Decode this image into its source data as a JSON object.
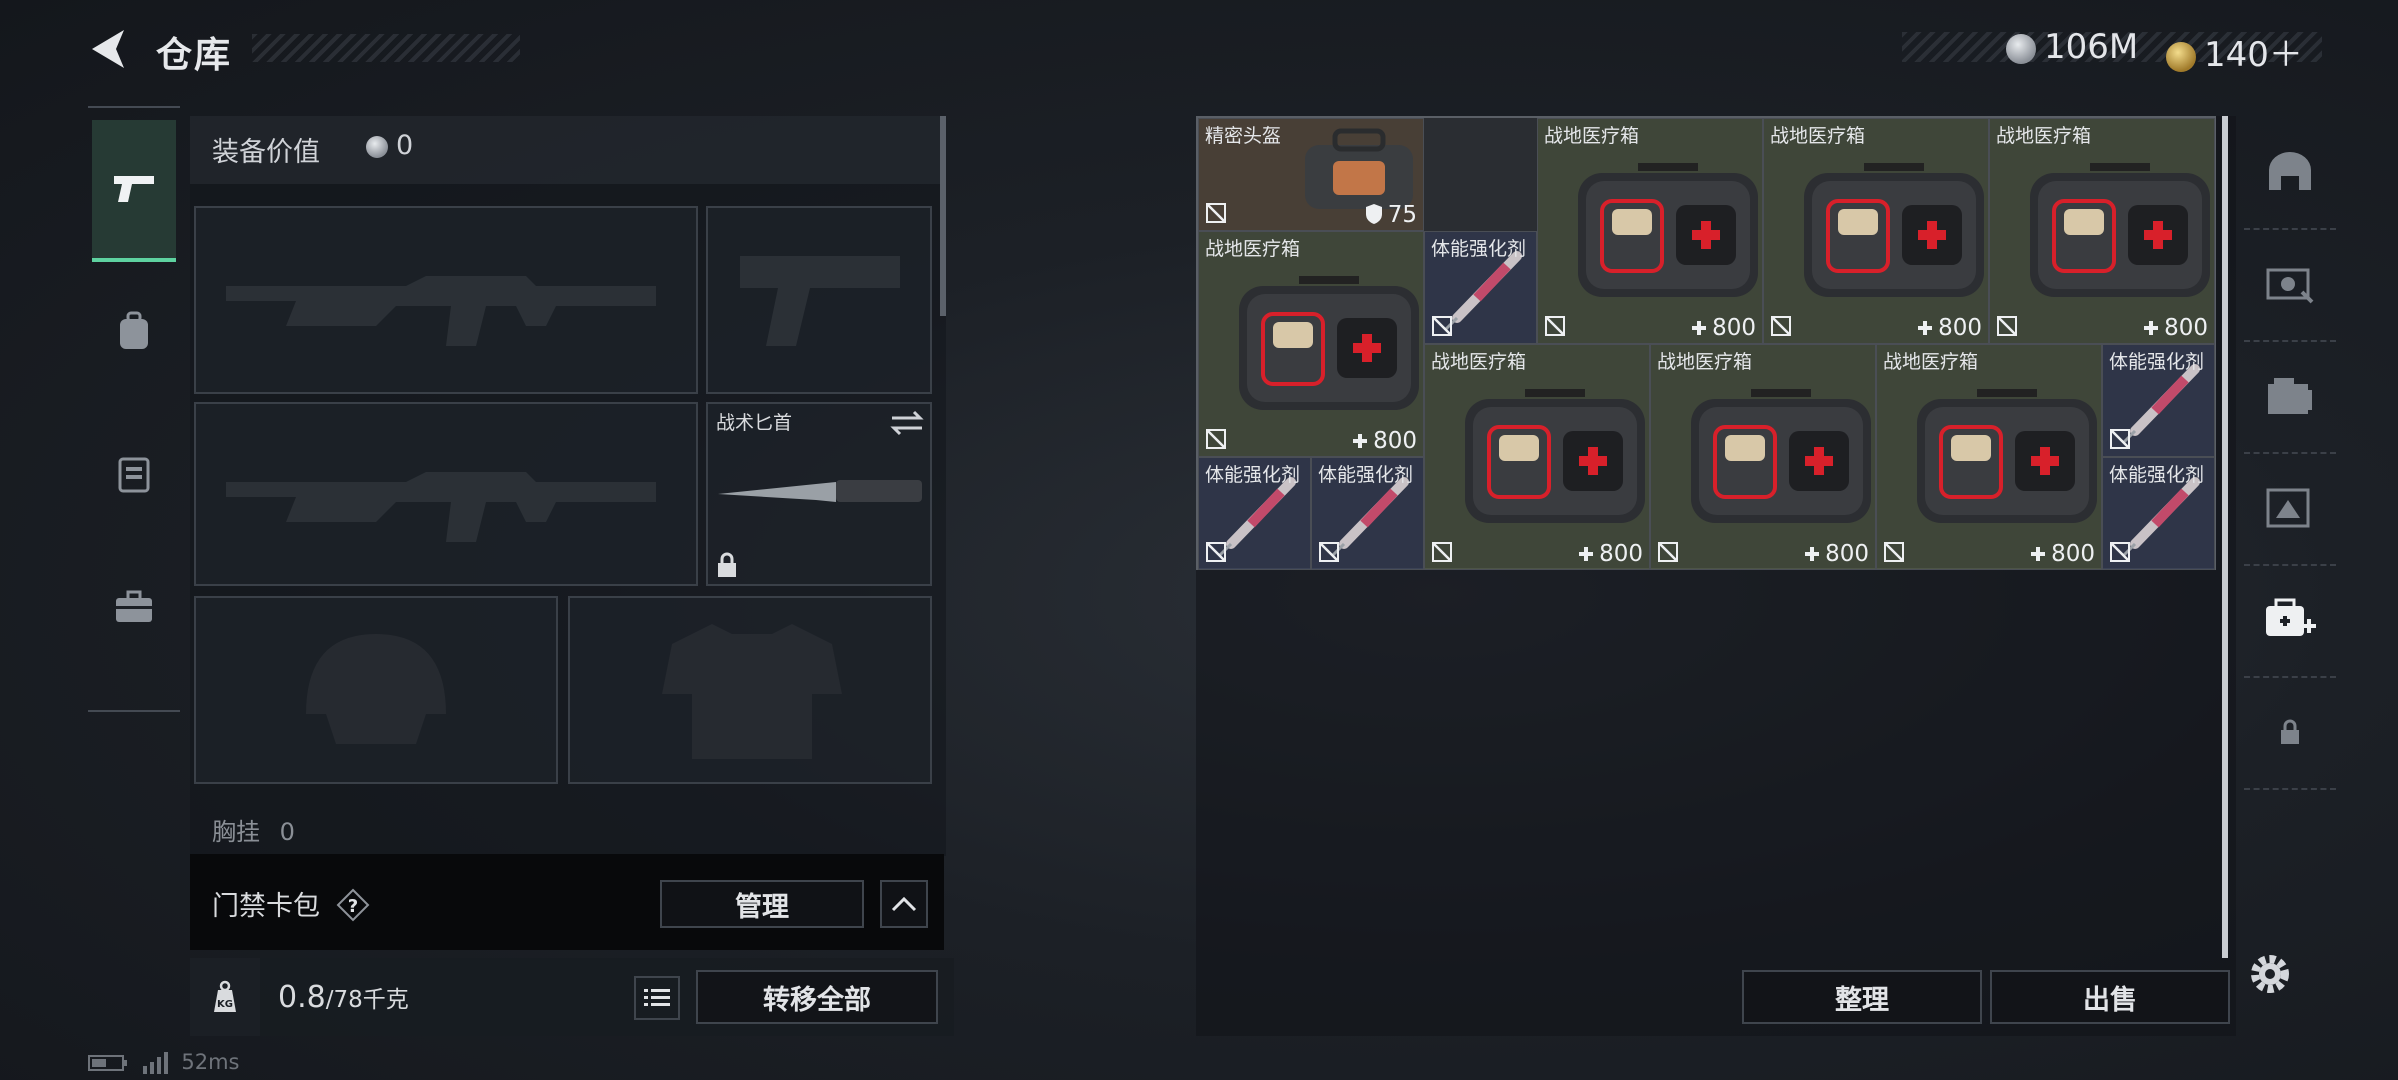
{
  "header": {
    "title": "仓库",
    "currency_silver": "106M",
    "currency_gold": "140＋"
  },
  "left_tabs": [
    "pistol-icon",
    "backpack-icon",
    "vest-icon",
    "toolbox-icon"
  ],
  "equipment": {
    "title": "装备价值",
    "value": "0",
    "knife_label": "战术匕首",
    "chest_rig_label": "胸挂",
    "chest_rig_value": "0"
  },
  "keycard": {
    "label": "门禁卡包",
    "help": "?",
    "manage": "管理"
  },
  "weight": {
    "current": "0.8",
    "capacity": "/78千克",
    "transfer_all": "转移全部",
    "kg_label": "KG"
  },
  "status": {
    "ping": "52ms"
  },
  "storage": {
    "tidy": "整理",
    "sell": "出售",
    "items": [
      {
        "name": "精密头盔",
        "value": "75",
        "type": "helm"
      },
      {
        "name": "战地医疗箱",
        "value": "800",
        "type": "med"
      },
      {
        "name": "战地医疗箱",
        "value": "800",
        "type": "med"
      },
      {
        "name": "战地医疗箱",
        "value": "800",
        "type": "med"
      },
      {
        "name": "战地医疗箱",
        "value": "800",
        "type": "med"
      },
      {
        "name": "体能强化剂",
        "value": "",
        "type": "inj"
      },
      {
        "name": "战地医疗箱",
        "value": "800",
        "type": "med"
      },
      {
        "name": "战地医疗箱",
        "value": "800",
        "type": "med"
      },
      {
        "name": "战地医疗箱",
        "value": "800",
        "type": "med"
      },
      {
        "name": "体能强化剂",
        "value": "",
        "type": "inj"
      },
      {
        "name": "体能强化剂",
        "value": "",
        "type": "inj"
      },
      {
        "name": "体能强化剂",
        "value": "",
        "type": "inj"
      },
      {
        "name": "体能强化剂",
        "value": "",
        "type": "inj"
      }
    ]
  },
  "right_tabs": [
    "helmet-category-icon",
    "gear-category-icon",
    "container-category-icon",
    "map-category-icon",
    "medical-category-icon",
    "lock-icon"
  ],
  "colors": {
    "accent": "#5ed2a0",
    "medkit_red": "#d8202a"
  }
}
